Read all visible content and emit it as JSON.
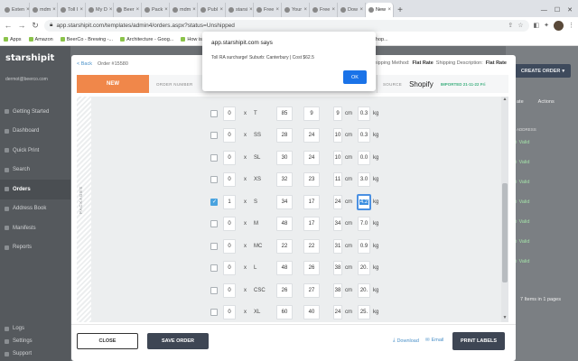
{
  "browser": {
    "tabs": [
      {
        "label": "Exten"
      },
      {
        "label": "mdm"
      },
      {
        "label": "Toll I"
      },
      {
        "label": "My D"
      },
      {
        "label": "Beer"
      },
      {
        "label": "Pack"
      },
      {
        "label": "mdm"
      },
      {
        "label": "Publ"
      },
      {
        "label": "starsi"
      },
      {
        "label": "Free"
      },
      {
        "label": "Your"
      },
      {
        "label": "Free"
      },
      {
        "label": "Dow"
      },
      {
        "label": "New",
        "active": true
      }
    ],
    "url": "app.starshipit.com/templates/admin4/orders.aspx?status=Unshipped",
    "bookmarks": [
      "Apps",
      "Amazon",
      "BeerCo - Brewing -...",
      "Architecture - Goog...",
      "How is e",
      "BeerCo.com.au ~ E...",
      "BeerCo.com.au ~ E...",
      "The powerful Shop..."
    ]
  },
  "sidebar": {
    "logo": "starshipit",
    "email": "dermot@beerco.com",
    "items": [
      "Getting Started",
      "Dashboard",
      "Quick Print",
      "Search",
      "Orders",
      "Address Book",
      "Manifests",
      "Reports"
    ],
    "bottom_items": [
      "Logs",
      "Settings",
      "Support"
    ]
  },
  "right_panel": {
    "create_order": "CREATE ORDER",
    "actions": [
      "ate",
      "Actions"
    ],
    "address_header": "ADDRESS",
    "valid_label": "Valid",
    "footer": "7 Items in 1 pages"
  },
  "modal": {
    "back": "< Back",
    "order_title": "Order #15580",
    "shipping_method_label": "Shipping Method:",
    "shipping_method": "Flat Rate",
    "shipping_desc_label": "Shipping Description:",
    "shipping_desc": "Flat Rate",
    "status": "NEW",
    "order_number_label": "ORDER NUMBER",
    "order_number": "#1558",
    "source_label": "SOURCE",
    "source": "Shopify",
    "imported": "IMPORTED 21-11-22 Fri",
    "packages_label": "PACKAGES",
    "packages": [
      {
        "qty": "0",
        "x": "x",
        "name": "T",
        "l": "85",
        "w": "9",
        "h": "9",
        "unit": "cm",
        "weight": "0.3",
        "wunit": "kg",
        "checked": false
      },
      {
        "qty": "0",
        "x": "x",
        "name": "SS",
        "l": "28",
        "w": "24",
        "h": "10",
        "unit": "cm",
        "weight": "0.3",
        "wunit": "kg",
        "checked": false
      },
      {
        "qty": "0",
        "x": "x",
        "name": "SL",
        "l": "30",
        "w": "24",
        "h": "10",
        "unit": "cm",
        "weight": "0.0",
        "wunit": "kg",
        "checked": false
      },
      {
        "qty": "0",
        "x": "x",
        "name": "XS",
        "l": "32",
        "w": "23",
        "h": "11",
        "unit": "cm",
        "weight": "3.0",
        "wunit": "kg",
        "checked": false
      },
      {
        "qty": "1",
        "x": "x",
        "name": "S",
        "l": "34",
        "w": "17",
        "h": "24",
        "unit": "cm",
        "weight": "4.2",
        "wunit": "kg",
        "checked": true
      },
      {
        "qty": "0",
        "x": "x",
        "name": "M",
        "l": "48",
        "w": "17",
        "h": "34",
        "unit": "cm",
        "weight": "7.0",
        "wunit": "kg",
        "checked": false
      },
      {
        "qty": "0",
        "x": "x",
        "name": "MC",
        "l": "22",
        "w": "22",
        "h": "31",
        "unit": "cm",
        "weight": "0.9",
        "wunit": "kg",
        "checked": false
      },
      {
        "qty": "0",
        "x": "x",
        "name": "L",
        "l": "48",
        "w": "26",
        "h": "38",
        "unit": "cm",
        "weight": "20.",
        "wunit": "kg",
        "checked": false
      },
      {
        "qty": "0",
        "x": "x",
        "name": "CSC",
        "l": "26",
        "w": "27",
        "h": "38",
        "unit": "cm",
        "weight": "20.",
        "wunit": "kg",
        "checked": false
      },
      {
        "qty": "0",
        "x": "x",
        "name": "XL",
        "l": "60",
        "w": "40",
        "h": "24",
        "unit": "cm",
        "weight": "25.",
        "wunit": "kg",
        "checked": false
      }
    ],
    "close": "CLOSE",
    "save": "SAVE ORDER",
    "download": "Download",
    "email": "Email",
    "print": "PRINT LABELS"
  },
  "alert": {
    "title": "app.starshipit.com says",
    "message": "Toll RA surcharge! Suburb: Canterbury | Cost $62.5",
    "ok": "OK"
  },
  "colors": {
    "status_new": "#f0874a",
    "primary_dark": "#3e4654",
    "dialog_ok": "#1a73e8",
    "valid_green": "#a3e0a8"
  }
}
